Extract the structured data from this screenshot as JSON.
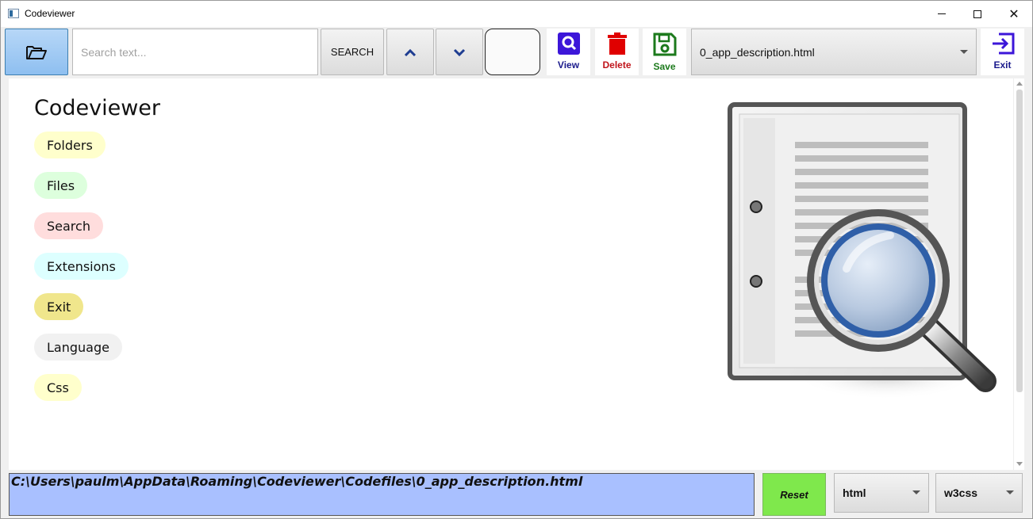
{
  "window": {
    "title": "Codeviewer"
  },
  "toolbar": {
    "search_placeholder": "Search text...",
    "search_label": "SEARCH",
    "up_glyph": "⌃",
    "down_glyph": "⌄",
    "view_label": "View",
    "delete_label": "Delete",
    "save_label": "Save",
    "file_selected": "0_app_description.html",
    "exit_label": "Exit"
  },
  "content": {
    "title": "Codeviewer",
    "tags": [
      {
        "label": "Folders",
        "color": "#ffffcc"
      },
      {
        "label": "Files",
        "color": "#ddffdd"
      },
      {
        "label": "Search",
        "color": "#ffdddd"
      },
      {
        "label": "Extensions",
        "color": "#ddffff"
      },
      {
        "label": "Exit",
        "color": "#f0e68c"
      },
      {
        "label": "Language",
        "color": "#f1f1f1"
      },
      {
        "label": "Css",
        "color": "#ffffcc"
      }
    ],
    "illustration_icon": "document-search-icon"
  },
  "footer": {
    "path": "C:\\Users\\paulm\\AppData\\Roaming\\Codeviewer\\Codefiles\\0_app_description.html",
    "reset_label": "Reset",
    "language_selected": "html",
    "css_selected": "w3css"
  },
  "colors": {
    "accent_blue": "#8ebff0",
    "path_bg": "#a9c0ff",
    "reset_green": "#7fe84c",
    "view_purple": "#3c16d9",
    "delete_red": "#e00000",
    "save_green": "#1c7a1c"
  }
}
